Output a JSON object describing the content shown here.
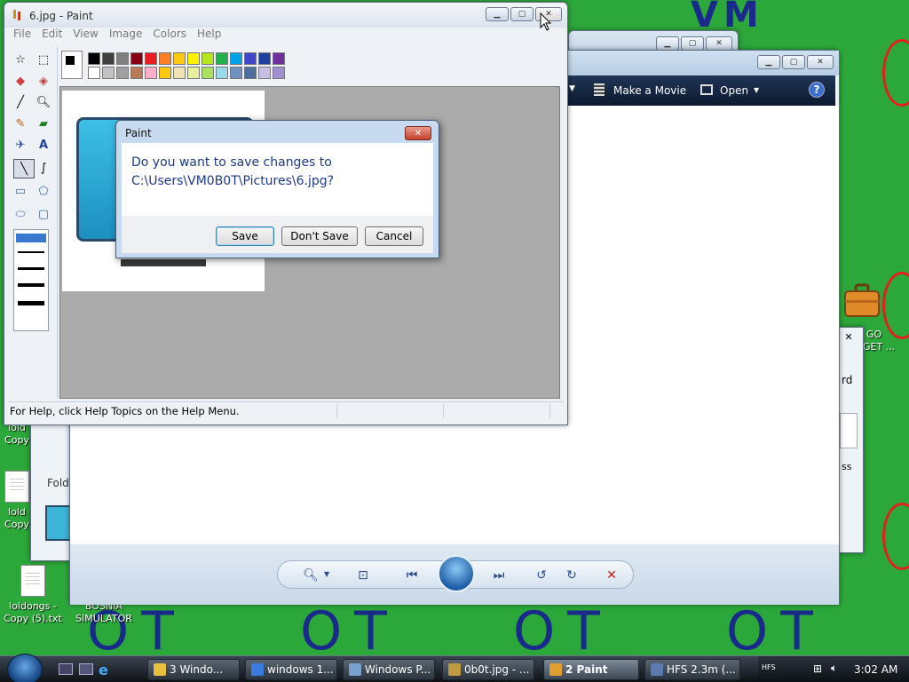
{
  "desktop": {
    "doodles": {
      "vm": "VM",
      "ot_1": "OT",
      "ot_2": "OT",
      "ot_3": "OT",
      "ot_4": "OT"
    },
    "icons": [
      {
        "label": "loldongs - Copy",
        "icon": "text-document-icon"
      },
      {
        "label": "loldongs - Copy (5).txt",
        "icon": "text-document-icon"
      },
      {
        "label": "BOSNIA SIMULATOR",
        "icon": "app-icon"
      },
      {
        "label": "GO GET ...",
        "icon": "briefcase-icon"
      }
    ],
    "partial_texts": {
      "rd": "rd",
      "ss": "ss",
      "folde": "Folde",
      "fold_a": "lold",
      "copy_a": "Copy",
      "fold_b": "lold",
      "copy_b": "Copy",
      "go": "GO",
      "get": "GET ..."
    }
  },
  "paint": {
    "title": "6.jpg - Paint",
    "menu": [
      "File",
      "Edit",
      "View",
      "Image",
      "Colors",
      "Help"
    ],
    "status": "For Help, click Help Topics on the Help Menu.",
    "palette_colors_row1": [
      "#000000",
      "#404040",
      "#7f7f7f",
      "#880015",
      "#ed1c24",
      "#ff7f27",
      "#ffc90e",
      "#fff200",
      "#b5e61d",
      "#22b14c",
      "#00a2e8",
      "#3f48cc",
      "#2040a0",
      "#7030a0"
    ],
    "palette_colors_row2": [
      "#ffffff",
      "#c3c3c3",
      "#a0a0a0",
      "#b97a57",
      "#ffaec9",
      "#ffc90e",
      "#efe4b0",
      "#e6f0a0",
      "#a8e060",
      "#99d9ea",
      "#7092be",
      "#4e6ea0",
      "#c8bfe7",
      "#a090d0"
    ],
    "primary_color": "#000000",
    "secondary_color": "#ffffff"
  },
  "dialog": {
    "title": "Paint",
    "message_line1": "Do you want to save changes to",
    "message_line2": "C:\\Users\\VM0B0T\\Pictures\\6.jpg?",
    "save": "Save",
    "dont_save": "Don't Save",
    "cancel": "Cancel"
  },
  "gallery": {
    "make_movie": "Make a Movie",
    "open": "Open"
  },
  "taskbar": {
    "items": [
      {
        "label": "3 Windo...",
        "color": "#e8c040"
      },
      {
        "label": "windows 1...",
        "color": "#3a7be0"
      },
      {
        "label": "Windows P...",
        "color": "#7aa0d0"
      },
      {
        "label": "0b0t.jpg - ...",
        "color": "#c09a40"
      },
      {
        "label": "2 Paint",
        "color": "#e0a030"
      },
      {
        "label": "HFS 2.3m (...",
        "color": "#5a7ab0"
      }
    ],
    "clock": "3:02 AM"
  }
}
